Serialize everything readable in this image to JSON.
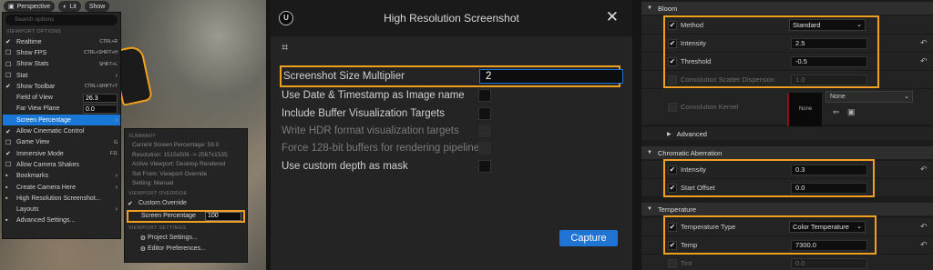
{
  "viewport": {
    "top_buttons": [
      "Perspective",
      "Lit",
      "Show"
    ],
    "search_placeholder": "Search options",
    "menu": {
      "header_viewport_options": "VIEWPORT OPTIONS",
      "items": [
        {
          "label": "Realtime",
          "shortcut": "CTRL+R",
          "checked": true
        },
        {
          "label": "Show FPS",
          "shortcut": "CTRL+SHIFT+H",
          "checked": false
        },
        {
          "label": "Show Stats",
          "shortcut": "SHIFT+L",
          "checked": false
        },
        {
          "label": "Stat",
          "shortcut": "",
          "checked": false,
          "submenu": true
        },
        {
          "label": "Show Toolbar",
          "shortcut": "CTRL+SHIFT+T",
          "checked": true
        },
        {
          "label": "Field of View",
          "value": "26.3"
        },
        {
          "label": "Far View Plane",
          "value": "0.0"
        },
        {
          "label": "Screen Percentage",
          "submenu": true,
          "active": true
        },
        {
          "label": "Allow Cinematic Control",
          "checked": true
        },
        {
          "label": "Game View",
          "shortcut": "G",
          "checked": false
        },
        {
          "label": "Immersive Mode",
          "shortcut": "F11",
          "checked": true
        },
        {
          "label": "Allow Camera Shakes",
          "checked": false
        },
        {
          "label": "Bookmarks",
          "submenu": true
        },
        {
          "label": "Create Camera Here",
          "submenu": true
        },
        {
          "label": "High Resolution Screenshot..."
        },
        {
          "label": "Layouts",
          "submenu": true
        },
        {
          "label": "Advanced Settings..."
        }
      ]
    },
    "submenu": {
      "header_summary": "SUMMARY",
      "summary_lines": [
        "Current Screen Percentage: 59.0",
        "Resolution: 1515x506 -> 2567x1535",
        "Active Viewport: Desktop Rendered",
        "Set From: Viewport Override",
        "Setting: Manual"
      ],
      "header_override": "VIEWPORT OVERRIDE",
      "custom_override": "Custom Override",
      "screen_percentage_label": "Screen Percentage",
      "screen_percentage_value": "100",
      "header_settings": "VIEWPORT SETTINGS",
      "project_settings": "Project Settings...",
      "editor_preferences": "Editor Preferences..."
    }
  },
  "dialog": {
    "title": "High Resolution Screenshot",
    "options": [
      {
        "label": "Screenshot Size Multiplier",
        "value": "2",
        "highlight": true
      },
      {
        "label": "Use Date & Timestamp as Image name",
        "disabled": false
      },
      {
        "label": "Include Buffer Visualization Targets",
        "disabled": false
      },
      {
        "label": "Write HDR format visualization targets",
        "disabled": true
      },
      {
        "label": "Force 128-bit buffers for rendering pipeline",
        "disabled": true
      },
      {
        "label": "Use custom depth as mask",
        "disabled": false
      }
    ],
    "capture_label": "Capture"
  },
  "details": {
    "bloom": {
      "title": "Bloom",
      "method_label": "Method",
      "method_value": "Standard",
      "intensity_label": "Intensity",
      "intensity_value": "2.5",
      "threshold_label": "Threshold",
      "threshold_value": "-0.5",
      "scatter_label": "Convolution Scatter Dispersion",
      "scatter_value": "1.0",
      "kernel_label": "Convolution Kernel",
      "kernel_value": "None",
      "kernel_thumb": "None",
      "advanced_label": "Advanced"
    },
    "chromatic": {
      "title": "Chromatic Aberration",
      "intensity_label": "Intensity",
      "intensity_value": "0.3",
      "start_label": "Start Offset",
      "start_value": "0.0"
    },
    "temperature": {
      "title": "Temperature",
      "type_label": "Temperature Type",
      "type_value": "Color Temperature",
      "temp_label": "Temp",
      "temp_value": "7300.0",
      "tint_label": "Tint",
      "tint_value": "0.0"
    }
  },
  "colors": {
    "accent": "#1977d5",
    "highlight": "#f0a020"
  }
}
